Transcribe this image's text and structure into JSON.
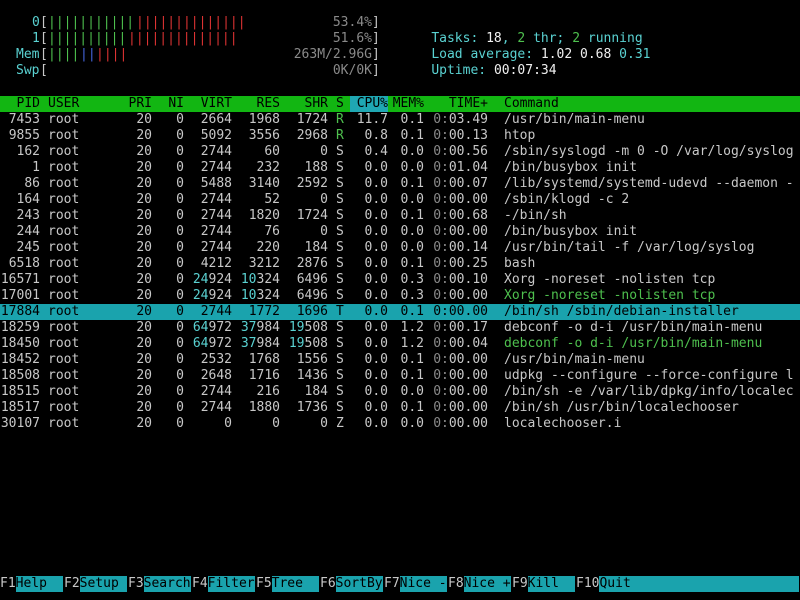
{
  "meters": {
    "cpu0": {
      "label": "0",
      "bar_green": "|||||||||||",
      "bar_red": "||||||||||||||",
      "value": "53.4%"
    },
    "cpu1": {
      "label": "1",
      "bar_green": "||||||||||",
      "bar_red": "||||||||||||||",
      "value": "51.6%"
    },
    "mem": {
      "label": "Mem",
      "bar_green": "||||",
      "bar_blue": "||",
      "bar_red": "||||",
      "value": "263M/2.96G"
    },
    "swp": {
      "label": "Swp",
      "value": "0K/0K"
    }
  },
  "summary": {
    "tasks_label": "Tasks:",
    "tasks": "18",
    "thr_sep": ",",
    "thr": "2",
    "thr_label": "thr;",
    "running": "2",
    "running_label": "running",
    "load_label": "Load average:",
    "load1": "1.02",
    "load5": "0.68",
    "load15": "0.31",
    "uptime_label": "Uptime:",
    "uptime": "00:07:34"
  },
  "columns": [
    "PID",
    "USER",
    "PRI",
    "NI",
    "VIRT",
    "RES",
    "SHR",
    "S",
    "CPU%",
    "MEM%",
    "TIME+",
    "Command"
  ],
  "processes": [
    {
      "pid": "7453",
      "user": "root",
      "pri": "20",
      "ni": "0",
      "virt": "2664",
      "res": "1968",
      "shr": "1724",
      "s": "R",
      "cpu": "11.7",
      "mem": "0.1",
      "time": "0:03.49",
      "cmd": "/usr/bin/main-menu"
    },
    {
      "pid": "9855",
      "user": "root",
      "pri": "20",
      "ni": "0",
      "virt": "5092",
      "res": "3556",
      "shr": "2968",
      "s": "R",
      "cpu": "0.8",
      "mem": "0.1",
      "time": "0:00.13",
      "cmd": "htop"
    },
    {
      "pid": "162",
      "user": "root",
      "pri": "20",
      "ni": "0",
      "virt": "2744",
      "res": "60",
      "shr": "0",
      "s": "S",
      "cpu": "0.4",
      "mem": "0.0",
      "time": "0:00.56",
      "cmd": "/sbin/syslogd -m 0 -O /var/log/syslog"
    },
    {
      "pid": "1",
      "user": "root",
      "pri": "20",
      "ni": "0",
      "virt": "2744",
      "res": "232",
      "shr": "188",
      "s": "S",
      "cpu": "0.0",
      "mem": "0.0",
      "time": "0:01.04",
      "cmd": "/bin/busybox init"
    },
    {
      "pid": "86",
      "user": "root",
      "pri": "20",
      "ni": "0",
      "virt": "5488",
      "res": "3140",
      "shr": "2592",
      "s": "S",
      "cpu": "0.0",
      "mem": "0.1",
      "time": "0:00.07",
      "cmd": "/lib/systemd/systemd-udevd --daemon -"
    },
    {
      "pid": "164",
      "user": "root",
      "pri": "20",
      "ni": "0",
      "virt": "2744",
      "res": "52",
      "shr": "0",
      "s": "S",
      "cpu": "0.0",
      "mem": "0.0",
      "time": "0:00.00",
      "cmd": "/sbin/klogd -c 2"
    },
    {
      "pid": "243",
      "user": "root",
      "pri": "20",
      "ni": "0",
      "virt": "2744",
      "res": "1820",
      "shr": "1724",
      "s": "S",
      "cpu": "0.0",
      "mem": "0.1",
      "time": "0:00.68",
      "cmd": "-/bin/sh"
    },
    {
      "pid": "244",
      "user": "root",
      "pri": "20",
      "ni": "0",
      "virt": "2744",
      "res": "76",
      "shr": "0",
      "s": "S",
      "cpu": "0.0",
      "mem": "0.0",
      "time": "0:00.00",
      "cmd": "/bin/busybox init"
    },
    {
      "pid": "245",
      "user": "root",
      "pri": "20",
      "ni": "0",
      "virt": "2744",
      "res": "220",
      "shr": "184",
      "s": "S",
      "cpu": "0.0",
      "mem": "0.0",
      "time": "0:00.14",
      "cmd": "/usr/bin/tail -f /var/log/syslog"
    },
    {
      "pid": "6518",
      "user": "root",
      "pri": "20",
      "ni": "0",
      "virt": "4212",
      "res": "3212",
      "shr": "2876",
      "s": "S",
      "cpu": "0.0",
      "mem": "0.1",
      "time": "0:00.25",
      "cmd": "bash"
    },
    {
      "pid": "16571",
      "user": "root",
      "pri": "20",
      "ni": "0",
      "virt": "24924",
      "res": "10324",
      "shr": "6496",
      "s": "S",
      "cpu": "0.0",
      "mem": "0.3",
      "time": "0:00.10",
      "cmd": "Xorg -noreset -nolisten tcp"
    },
    {
      "pid": "17001",
      "user": "root",
      "pri": "20",
      "ni": "0",
      "virt": "24924",
      "res": "10324",
      "shr": "6496",
      "s": "S",
      "cpu": "0.0",
      "mem": "0.3",
      "time": "0:00.00",
      "cmd": "Xorg -noreset -nolisten tcp",
      "thread": true
    },
    {
      "pid": "17884",
      "user": "root",
      "pri": "20",
      "ni": "0",
      "virt": "2744",
      "res": "1772",
      "shr": "1696",
      "s": "T",
      "cpu": "0.0",
      "mem": "0.1",
      "time": "0:00.00",
      "cmd": "/bin/sh /sbin/debian-installer",
      "selected": true
    },
    {
      "pid": "18259",
      "user": "root",
      "pri": "20",
      "ni": "0",
      "virt": "64972",
      "res": "37984",
      "shr": "19508",
      "s": "S",
      "cpu": "0.0",
      "mem": "1.2",
      "time": "0:00.17",
      "cmd": "debconf -o d-i /usr/bin/main-menu"
    },
    {
      "pid": "18450",
      "user": "root",
      "pri": "20",
      "ni": "0",
      "virt": "64972",
      "res": "37984",
      "shr": "19508",
      "s": "S",
      "cpu": "0.0",
      "mem": "1.2",
      "time": "0:00.04",
      "cmd": "debconf -o d-i /usr/bin/main-menu",
      "thread": true
    },
    {
      "pid": "18452",
      "user": "root",
      "pri": "20",
      "ni": "0",
      "virt": "2532",
      "res": "1768",
      "shr": "1556",
      "s": "S",
      "cpu": "0.0",
      "mem": "0.1",
      "time": "0:00.00",
      "cmd": "/usr/bin/main-menu"
    },
    {
      "pid": "18508",
      "user": "root",
      "pri": "20",
      "ni": "0",
      "virt": "2648",
      "res": "1716",
      "shr": "1436",
      "s": "S",
      "cpu": "0.0",
      "mem": "0.1",
      "time": "0:00.00",
      "cmd": "udpkg --configure --force-configure l"
    },
    {
      "pid": "18515",
      "user": "root",
      "pri": "20",
      "ni": "0",
      "virt": "2744",
      "res": "216",
      "shr": "184",
      "s": "S",
      "cpu": "0.0",
      "mem": "0.0",
      "time": "0:00.00",
      "cmd": "/bin/sh -e /var/lib/dpkg/info/localec"
    },
    {
      "pid": "18517",
      "user": "root",
      "pri": "20",
      "ni": "0",
      "virt": "2744",
      "res": "1880",
      "shr": "1736",
      "s": "S",
      "cpu": "0.0",
      "mem": "0.1",
      "time": "0:00.00",
      "cmd": "/bin/sh /usr/bin/localechooser"
    },
    {
      "pid": "30107",
      "user": "root",
      "pri": "20",
      "ni": "0",
      "virt": "0",
      "res": "0",
      "shr": "0",
      "s": "Z",
      "cpu": "0.0",
      "mem": "0.0",
      "time": "0:00.00",
      "cmd": "localechooser.i"
    }
  ],
  "footer": [
    {
      "key": "F1",
      "label": "Help  "
    },
    {
      "key": "F2",
      "label": "Setup "
    },
    {
      "key": "F3",
      "label": "Search"
    },
    {
      "key": "F4",
      "label": "Filter"
    },
    {
      "key": "F5",
      "label": "Tree  "
    },
    {
      "key": "F6",
      "label": "SortBy"
    },
    {
      "key": "F7",
      "label": "Nice -"
    },
    {
      "key": "F8",
      "label": "Nice +"
    },
    {
      "key": "F9",
      "label": "Kill  "
    },
    {
      "key": "F10",
      "label": "Quit  "
    }
  ],
  "colors": {
    "header_bg": "#12b612",
    "selection_bg": "#1aa3ad",
    "thread_fg": "#4ec04e"
  }
}
